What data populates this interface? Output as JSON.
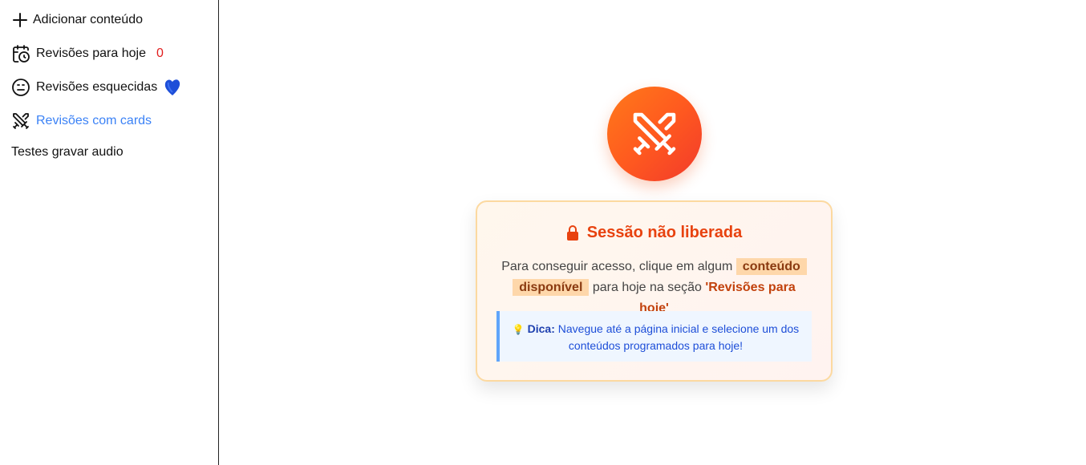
{
  "sidebar": {
    "items": [
      {
        "label": "Adicionar conteúdo",
        "icon": "plus-icon"
      },
      {
        "label": "Revisões para hoje",
        "icon": "calendar-clock-icon",
        "count": "0"
      },
      {
        "label": "Revisões esquecidas",
        "icon": "neutral-face-icon",
        "decoration": "blue-heart-icon"
      },
      {
        "label": "Revisões com cards",
        "icon": "crossed-swords-icon",
        "active": true
      },
      {
        "label": "Testes gravar audio"
      }
    ]
  },
  "main": {
    "hero_icon": "crossed-swords-icon",
    "card": {
      "title": "Sessão não liberada",
      "title_icon": "lock-icon",
      "body_prefix": "Para conseguir acesso, clique em algum",
      "body_highlight_1": "conteúdo",
      "body_highlight_2": "disponível",
      "body_middle": "para hoje na seção",
      "body_section": "'Revisões para hoje'",
      "tip_icon": "💡",
      "tip_label": "Dica:",
      "tip_text": "Navegue até a página inicial e selecione um dos conteúdos programados para hoje!"
    }
  },
  "colors": {
    "accent_blue": "#3b82f6",
    "count_red": "#e11d1d",
    "title_orange": "#e8420f",
    "tip_blue": "#1d4ed8"
  }
}
